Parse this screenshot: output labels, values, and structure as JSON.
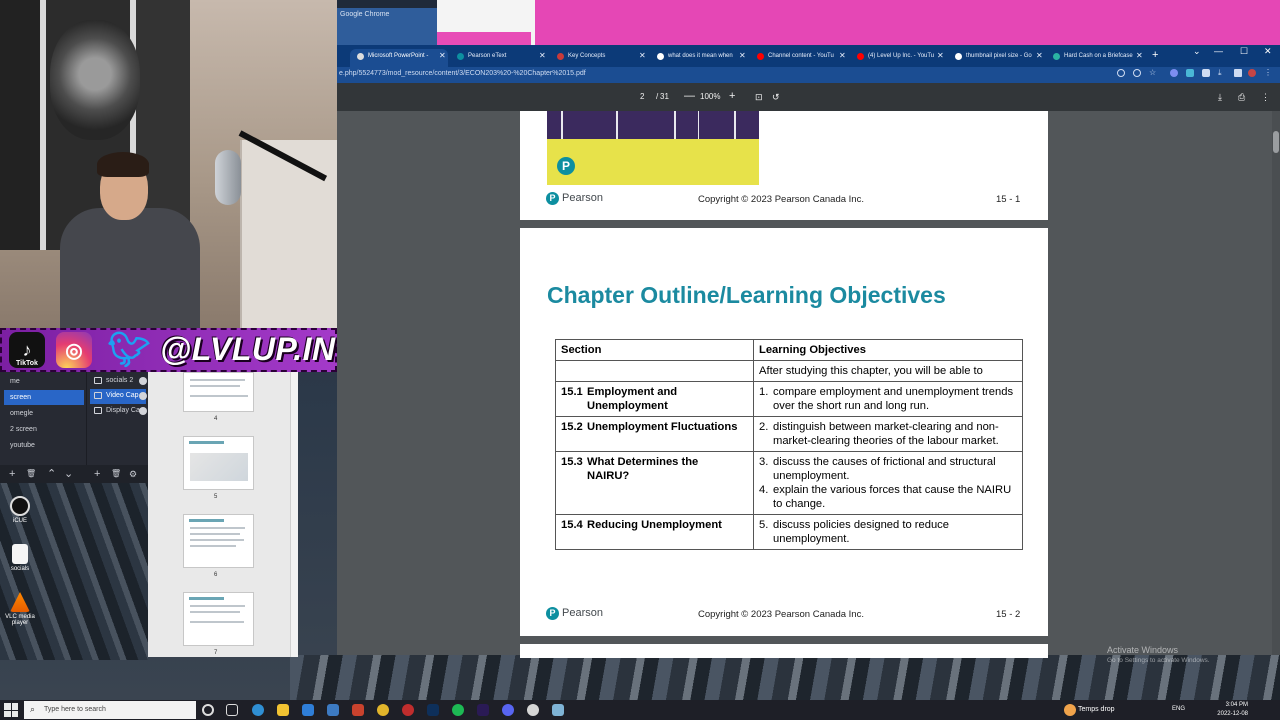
{
  "background_windows": {
    "chrome_title": "Google Chrome"
  },
  "webcam": {
    "social_handle": "@LVLUP.INC",
    "tiktok_label": "TikTok"
  },
  "obs": {
    "scenes": [
      "me",
      "screen",
      "omegle",
      "2 screen",
      "youtube"
    ],
    "active_scene": "screen",
    "sources": [
      "socials 2",
      "Video Cap",
      "Display Ca"
    ],
    "active_source": "Video Cap",
    "controls": [
      "+",
      "🗑",
      "⌃",
      "⌄",
      "+",
      "🗑",
      "⚙"
    ]
  },
  "desktop_icons": [
    "iCUE",
    "socials",
    "VLC media player"
  ],
  "powerpoint": {
    "thumb_numbers": [
      "4",
      "5",
      "6",
      "7"
    ]
  },
  "chrome": {
    "tabs": [
      {
        "label": "Microsoft PowerPoint - ",
        "active": true
      },
      {
        "label": "Pearson eText",
        "active": false
      },
      {
        "label": "Key Concepts",
        "active": false
      },
      {
        "label": "what does it mean when",
        "active": false
      },
      {
        "label": "Channel content - YouTu",
        "active": false
      },
      {
        "label": "(4) Level Up Inc. - YouTu",
        "active": false
      },
      {
        "label": "thumbnail pixel size - Go",
        "active": false
      },
      {
        "label": "Hard Cash on a Briefcase",
        "active": false
      }
    ],
    "url": "e.php/5524773/mod_resource/content/3/ECON203%20-%20Chapter%2015.pdf",
    "window_controls": {
      "minimize": "—",
      "maximize": "☐",
      "close": "✕"
    },
    "new_tab": "+"
  },
  "pdf": {
    "current_page": "2",
    "total_pages": "31",
    "page_separator": "/",
    "zoom": "100%",
    "zoom_minus": "—",
    "zoom_plus": "+"
  },
  "slide1_footer": {
    "brand": "Pearson",
    "copyright": "Copyright © 2023 Pearson Canada Inc.",
    "number": "15 - 1"
  },
  "slide2": {
    "title": "Chapter Outline/Learning Objectives",
    "table": {
      "headers": [
        "Section",
        "Learning Objectives"
      ],
      "intro": "After studying this chapter, you will be able to",
      "rows": [
        {
          "num": "15.1",
          "section_line1": "Employment and",
          "section_line2": "Unemployment",
          "objectives": [
            {
              "num": "1.",
              "text": "compare employment and unemployment trends over the short run and long run."
            }
          ]
        },
        {
          "num": "15.2",
          "section_line1": "Unemployment Fluctuations",
          "section_line2": "",
          "objectives": [
            {
              "num": "2.",
              "text": "distinguish between market-clearing and non-market-clearing theories of the labour market."
            }
          ]
        },
        {
          "num": "15.3",
          "section_line1": "What Determines the",
          "section_line2": "NAIRU?",
          "objectives": [
            {
              "num": "3.",
              "text": "discuss the causes of frictional and structural unemployment."
            },
            {
              "num": "4.",
              "text": "explain the various forces that cause the NAIRU to change."
            }
          ]
        },
        {
          "num": "15.4",
          "section_line1": "Reducing Unemployment",
          "section_line2": "",
          "objectives": [
            {
              "num": "5.",
              "text": "discuss policies designed to reduce unemployment."
            }
          ]
        }
      ]
    },
    "footer": {
      "brand": "Pearson",
      "copyright": "Copyright © 2023 Pearson Canada Inc.",
      "number": "15 - 2"
    }
  },
  "watermark": {
    "line1": "Activate Windows",
    "line2": "Go to Settings to activate Windows."
  },
  "taskbar": {
    "search_placeholder": "Type here to search",
    "weather": "Temps drop",
    "language": "ENG",
    "time": "3:04 PM",
    "date": "2022-12-08"
  },
  "colors": {
    "slide_title": "#1b8aa0",
    "pearson_teal": "#0d8fa0",
    "obs_selection": "#2966c7",
    "chrome_tabbar": "#0c3a78",
    "banner_purple": "#a43ac9"
  }
}
